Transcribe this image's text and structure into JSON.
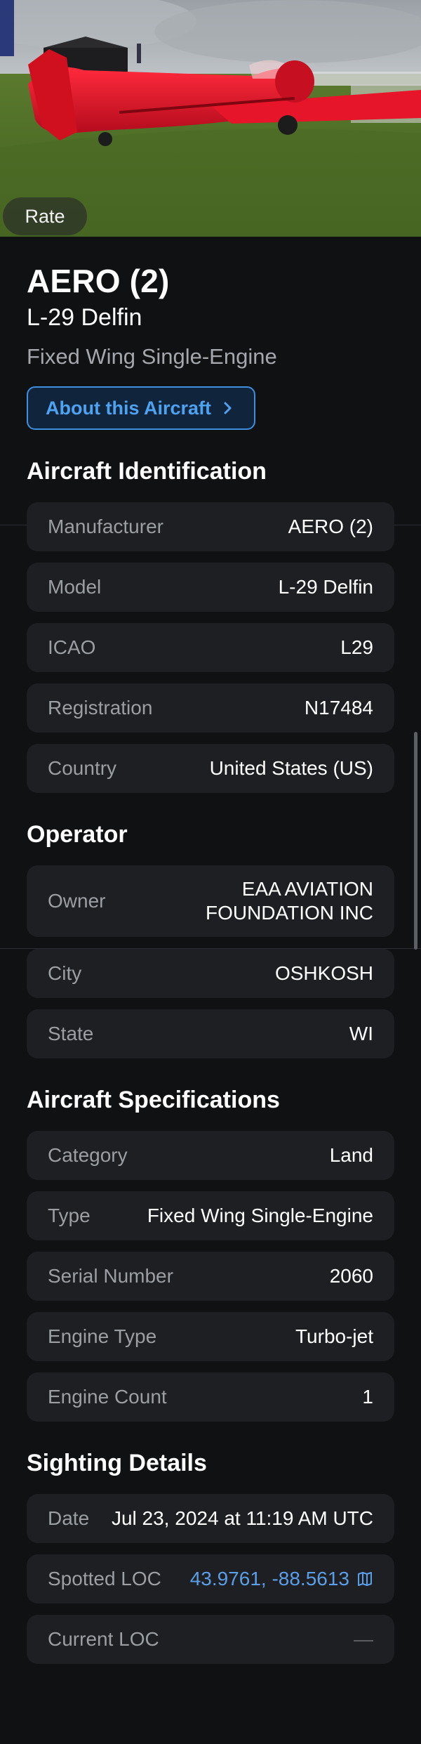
{
  "hero": {
    "rate_label": "Rate"
  },
  "header": {
    "title": "AERO (2)",
    "subtitle": "L-29 Delfin",
    "category": "Fixed Wing Single-Engine",
    "about_label": "About this Aircraft"
  },
  "identification": {
    "heading": "Aircraft Identification",
    "rows": [
      {
        "label": "Manufacturer",
        "value": "AERO (2)"
      },
      {
        "label": "Model",
        "value": "L-29 Delfin"
      },
      {
        "label": "ICAO",
        "value": "L29"
      },
      {
        "label": "Registration",
        "value": "N17484"
      },
      {
        "label": "Country",
        "value": "United States (US)"
      }
    ]
  },
  "operator": {
    "heading": "Operator",
    "rows": [
      {
        "label": "Owner",
        "value": "EAA AVIATION FOUNDATION INC"
      },
      {
        "label": "City",
        "value": "OSHKOSH"
      },
      {
        "label": "State",
        "value": "WI"
      }
    ]
  },
  "specifications": {
    "heading": "Aircraft Specifications",
    "rows": [
      {
        "label": "Category",
        "value": "Land"
      },
      {
        "label": "Type",
        "value": "Fixed Wing Single-Engine"
      },
      {
        "label": "Serial Number",
        "value": "2060"
      },
      {
        "label": "Engine Type",
        "value": "Turbo-jet"
      },
      {
        "label": "Engine Count",
        "value": "1"
      }
    ]
  },
  "sighting": {
    "heading": "Sighting Details",
    "rows": [
      {
        "label": "Date",
        "value": "Jul 23, 2024 at 11:19 AM UTC"
      },
      {
        "label": "Spotted LOC",
        "value": "43.9761, -88.5613",
        "icon": "map-icon"
      },
      {
        "label": "Current LOC",
        "value": "—"
      }
    ]
  },
  "colors": {
    "background": "#0f1113",
    "card": "#1d1f22",
    "accent": "#4ea2f2",
    "aircraft": "#e0142b"
  }
}
